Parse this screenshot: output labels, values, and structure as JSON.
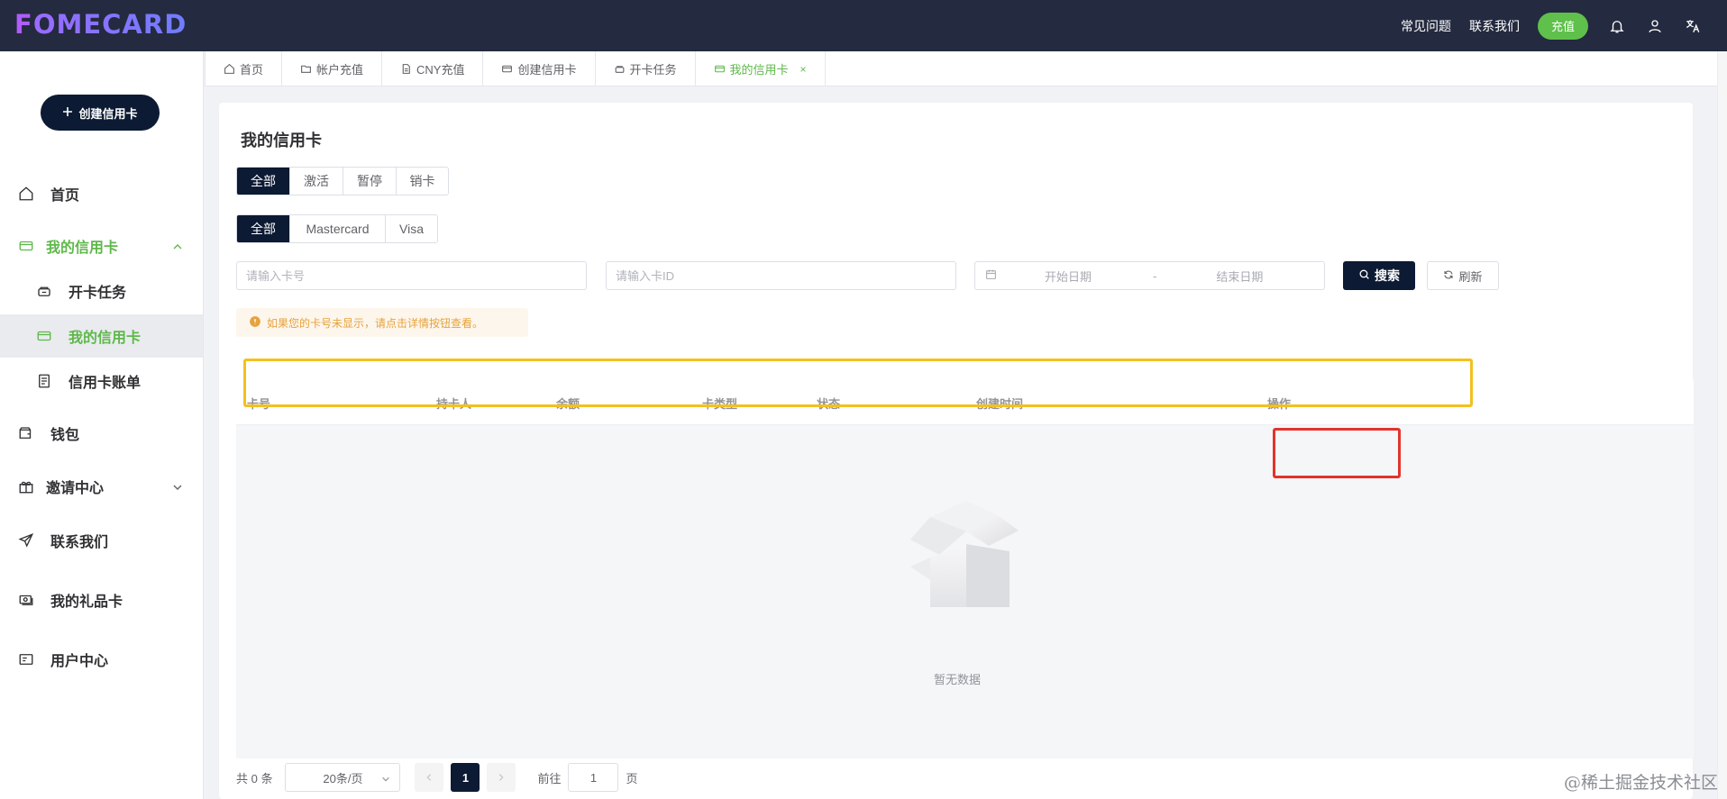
{
  "header": {
    "logo_first": "F",
    "logo_rest": "OMECARD",
    "links": [
      "常见问题",
      "联系我们"
    ],
    "recharge_label": "充值",
    "icons": [
      "bell-icon",
      "user-icon",
      "translate-icon"
    ]
  },
  "sidebar": {
    "create_button_label": "创建信用卡",
    "items": [
      {
        "label": "首页",
        "icon": "home-icon"
      },
      {
        "label": "我的信用卡",
        "icon": "card-icon",
        "expanded": true
      },
      {
        "label": "开卡任务",
        "icon": "task-icon"
      },
      {
        "label": "我的信用卡",
        "icon": "card-icon",
        "active": true
      },
      {
        "label": "信用卡账单",
        "icon": "bill-icon"
      },
      {
        "label": "钱包",
        "icon": "wallet-icon"
      },
      {
        "label": "邀请中心",
        "icon": "gift-icon",
        "expandable": true
      },
      {
        "label": "联系我们",
        "icon": "send-icon"
      },
      {
        "label": "我的礼品卡",
        "icon": "giftcard-icon"
      },
      {
        "label": "用户中心",
        "icon": "id-card-icon"
      }
    ]
  },
  "tabs": [
    {
      "label": "首页",
      "icon": "home-icon"
    },
    {
      "label": "帐户充值",
      "icon": "folder-icon"
    },
    {
      "label": "CNY充值",
      "icon": "doc-icon"
    },
    {
      "label": "创建信用卡",
      "icon": "card-icon"
    },
    {
      "label": "开卡任务",
      "icon": "task-icon"
    },
    {
      "label": "我的信用卡",
      "icon": "card-icon",
      "active": true,
      "close": "×"
    }
  ],
  "main": {
    "title": "我的信用卡",
    "status_filter": [
      "全部",
      "激活",
      "暂停",
      "销卡"
    ],
    "brand_filter": [
      "全部",
      "Mastercard",
      "Visa"
    ],
    "card_no_placeholder": "请输入卡号",
    "card_id_placeholder": "请输入卡ID",
    "start_date_placeholder": "开始日期",
    "date_separator": "-",
    "end_date_placeholder": "结束日期",
    "search_label": "搜索",
    "refresh_label": "刷新",
    "notice": "如果您的卡号未显示，请点击详情按钮查看。",
    "columns": [
      "卡号",
      "持卡人",
      "余额",
      "卡类型",
      "状态",
      "创建时间",
      "操作"
    ],
    "empty_text": "暂无数据"
  },
  "pagination": {
    "total": "共 0 条",
    "page_size": "20条/页",
    "current_page": "1",
    "goto_label": "前往",
    "goto_value": "1",
    "page_suffix": "页"
  },
  "watermark": "@稀土掘金技术社区",
  "colors": {
    "topbar": "#242a3f",
    "accent_green": "#5fb84b",
    "dark_navy": "#0c1a33",
    "highlight_yellow": "#f4c01e",
    "highlight_red": "#e2342b"
  }
}
